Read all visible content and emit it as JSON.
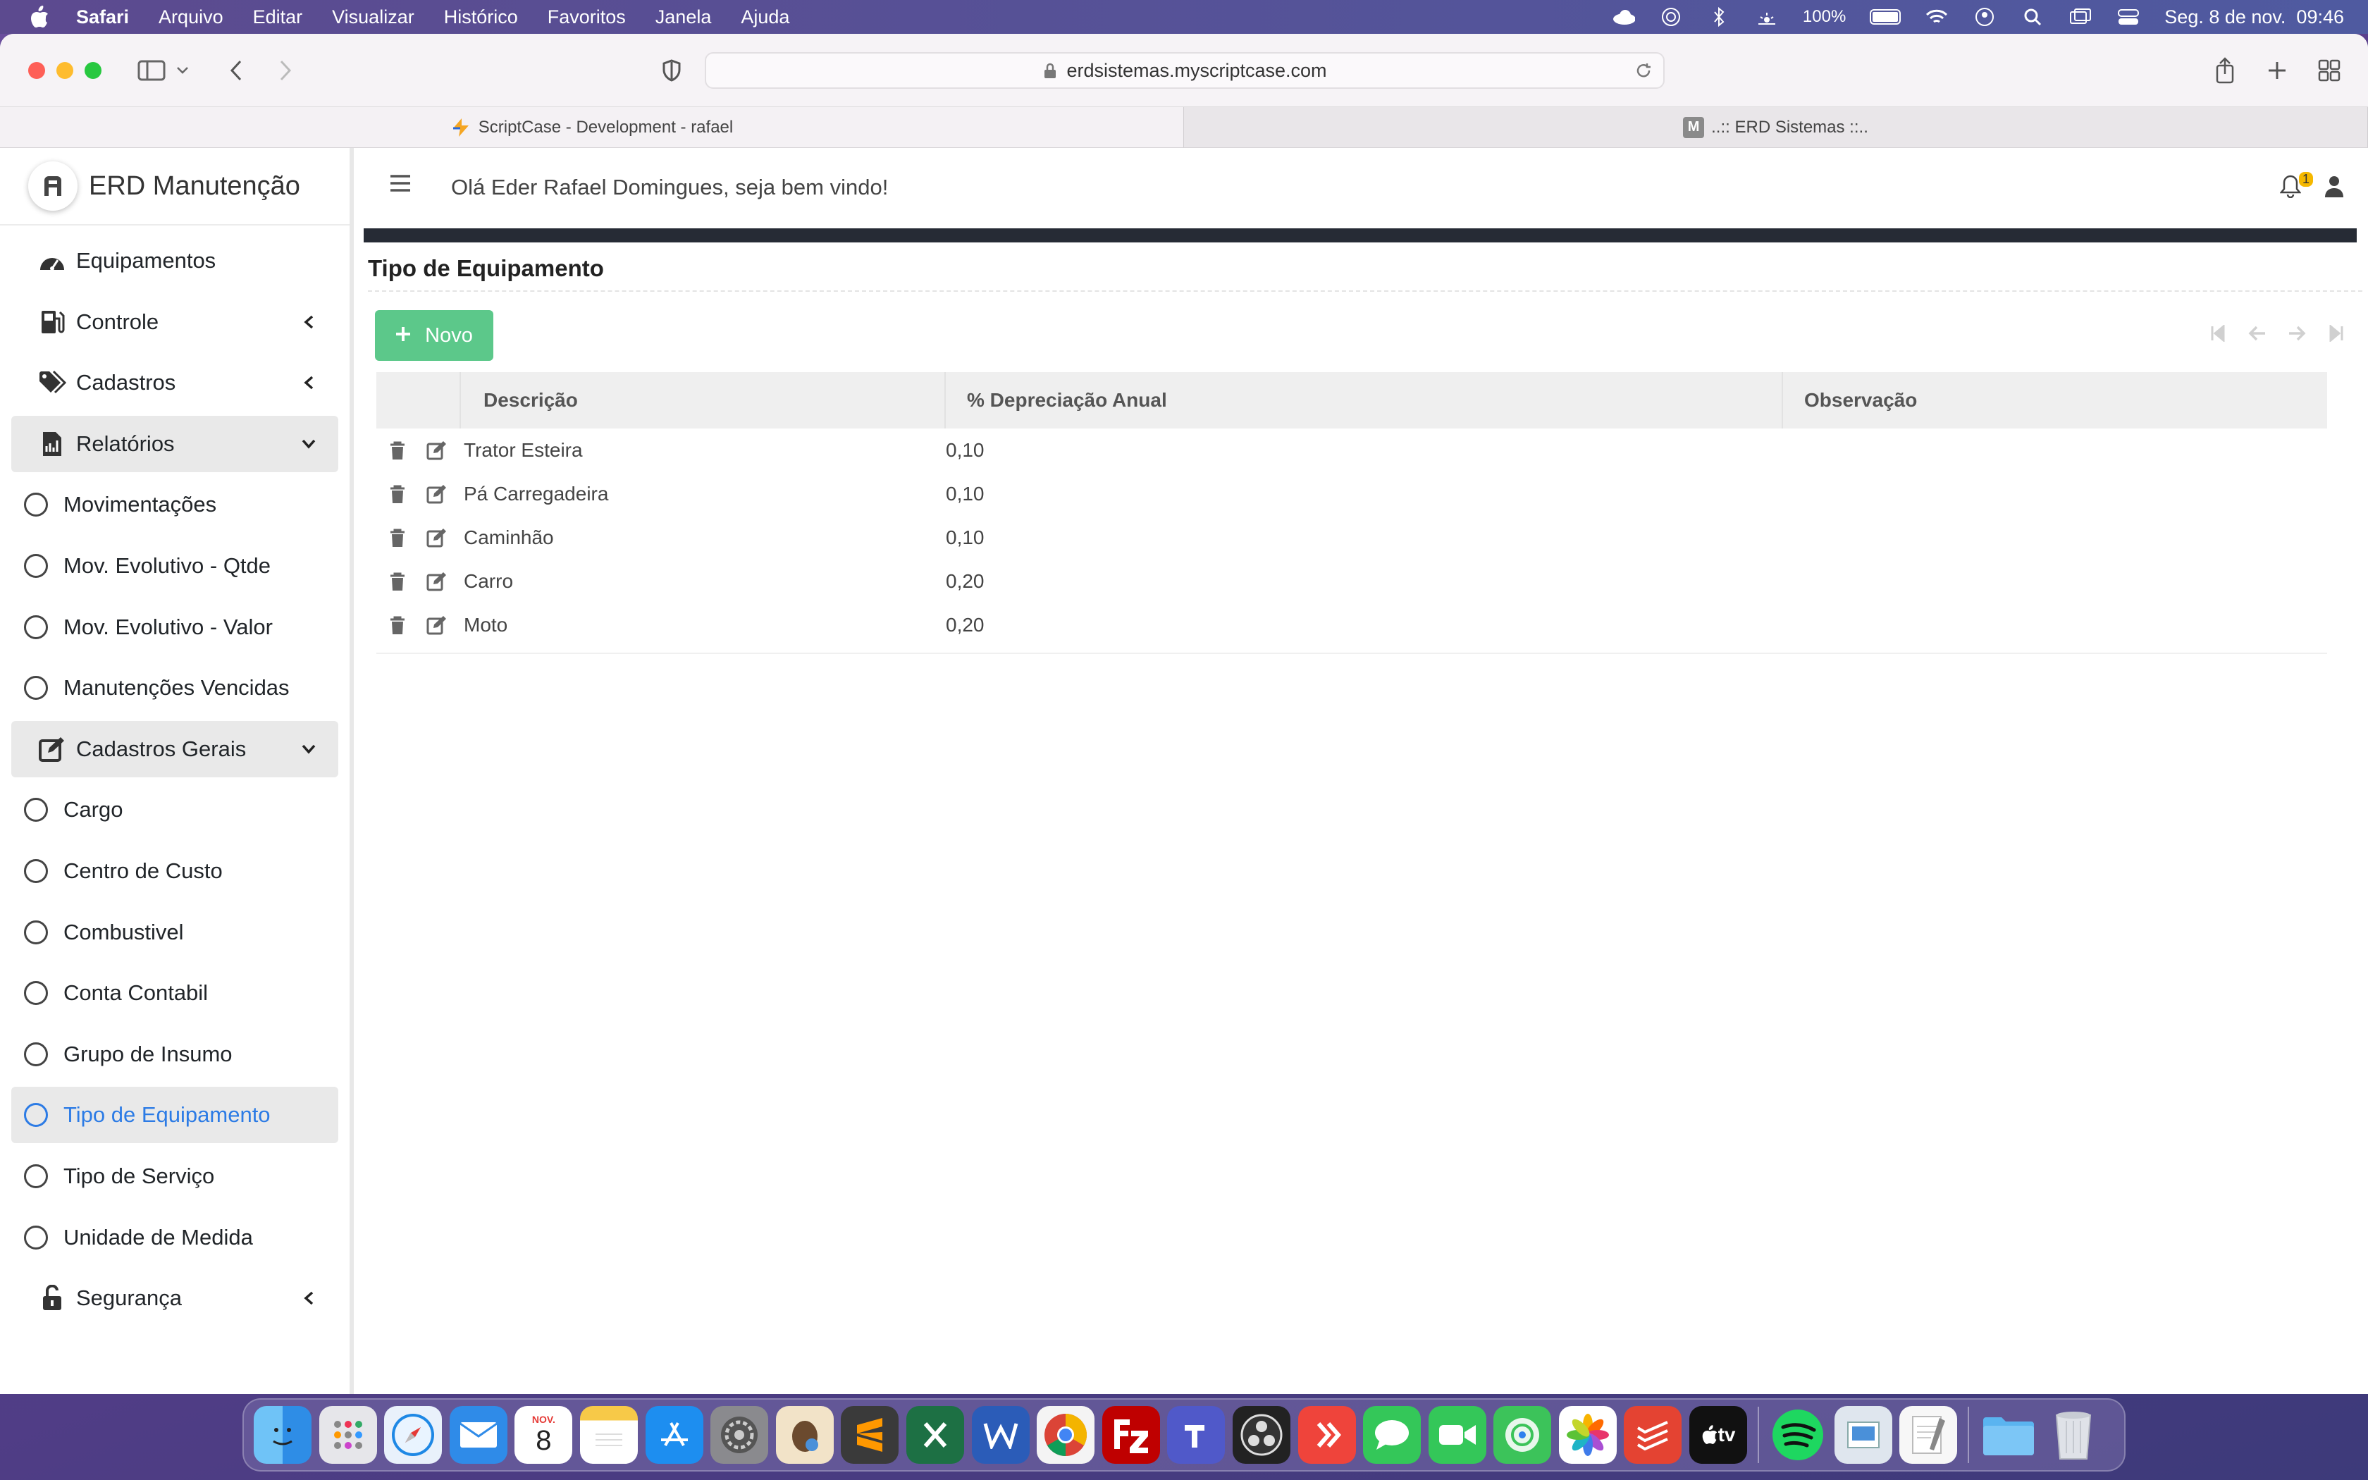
{
  "menubar": {
    "items": [
      "Safari",
      "Arquivo",
      "Editar",
      "Visualizar",
      "Histórico",
      "Favoritos",
      "Janela",
      "Ajuda"
    ],
    "battery": "100%",
    "datetime": "Seg. 8 de nov.  09:46"
  },
  "browser": {
    "url": "erdsistemas.myscriptcase.com",
    "tabs": [
      {
        "label": "ScriptCase - Development - rafael",
        "icon": "scriptcase-icon"
      },
      {
        "label": "..:: ERD Sistemas ::..",
        "icon": "m-icon",
        "icon_letter": "M"
      }
    ]
  },
  "sidebar": {
    "brand": "ERD Manutenção",
    "items": [
      {
        "label": "Equipamentos"
      },
      {
        "label": "Controle"
      },
      {
        "label": "Cadastros"
      },
      {
        "label": "Relatórios"
      },
      {
        "label": "Movimentações"
      },
      {
        "label": "Mov. Evolutivo - Qtde"
      },
      {
        "label": "Mov. Evolutivo - Valor"
      },
      {
        "label": "Manutenções Vencidas"
      },
      {
        "label": "Cadastros Gerais"
      },
      {
        "label": "Cargo"
      },
      {
        "label": "Centro de Custo"
      },
      {
        "label": "Combustivel"
      },
      {
        "label": "Conta Contabil"
      },
      {
        "label": "Grupo de Insumo"
      },
      {
        "label": "Tipo de Equipamento"
      },
      {
        "label": "Tipo de Serviço"
      },
      {
        "label": "Unidade de Medida"
      },
      {
        "label": "Segurança"
      }
    ]
  },
  "header": {
    "welcome": "Olá Eder Rafael Domingues, seja bem vindo!",
    "notification_count": "1"
  },
  "main": {
    "title": "Tipo de Equipamento",
    "new_button": "Novo",
    "columns": [
      "Descrição",
      "% Depreciação Anual",
      "Observação"
    ],
    "rows": [
      {
        "descricao": "Trator Esteira",
        "depreciacao": "0,10",
        "observacao": ""
      },
      {
        "descricao": "Pá Carregadeira",
        "depreciacao": "0,10",
        "observacao": ""
      },
      {
        "descricao": "Caminhão",
        "depreciacao": "0,10",
        "observacao": ""
      },
      {
        "descricao": "Carro",
        "depreciacao": "0,20",
        "observacao": ""
      },
      {
        "descricao": "Moto",
        "depreciacao": "0,20",
        "observacao": ""
      }
    ]
  },
  "dock": {
    "calendar_month": "NOV.",
    "calendar_day": "8",
    "tv_label": "tv"
  },
  "colors": {
    "accent_green": "#5cc88a",
    "active_link": "#2c7be5",
    "dark_bar": "#262b35"
  }
}
